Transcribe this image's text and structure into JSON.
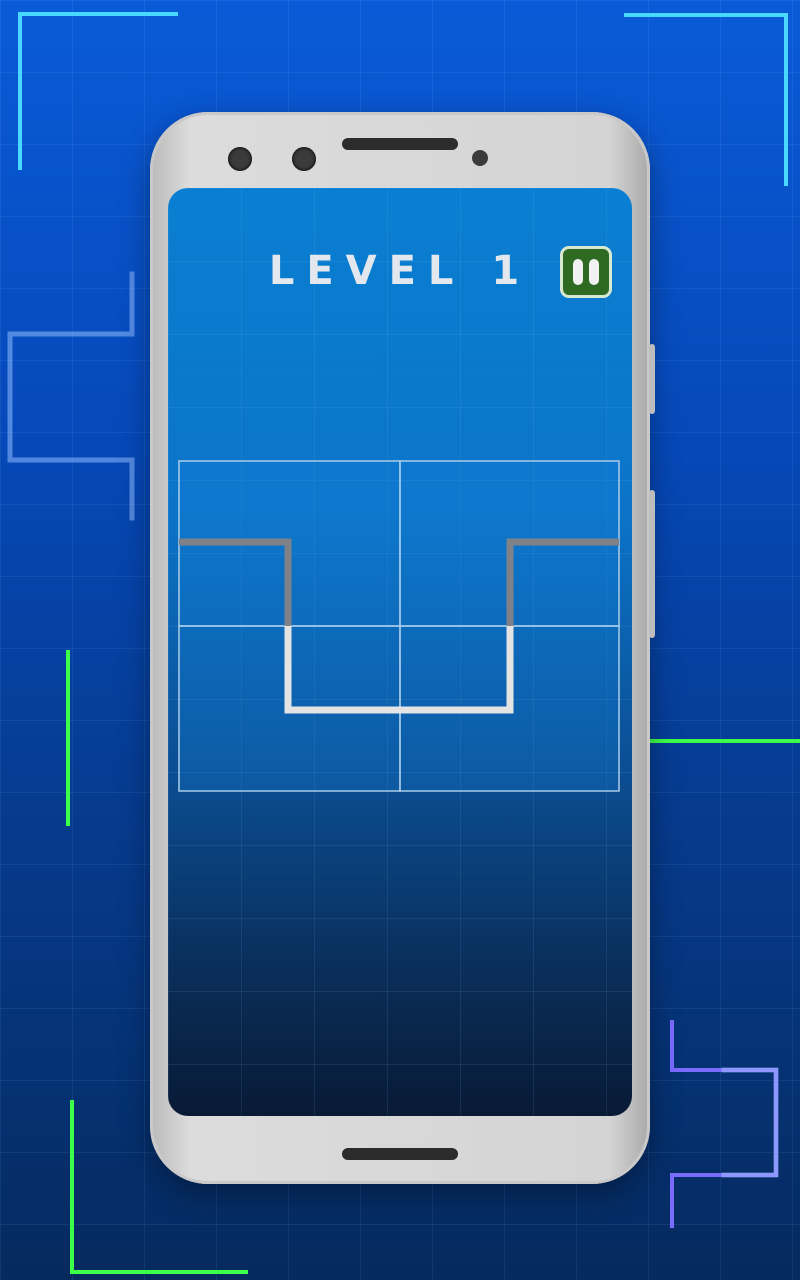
{
  "header": {
    "title": "LEVEL 1",
    "pause_icon": "pause-icon"
  },
  "board": {
    "rows": 2,
    "cols": 2,
    "tiles": [
      {
        "row": 0,
        "col": 0,
        "segments": [
          "left-to-right-then-down"
        ],
        "color": "#7e8288"
      },
      {
        "row": 0,
        "col": 1,
        "segments": [
          "left-up-then-right"
        ],
        "color": "#7e8288"
      },
      {
        "row": 1,
        "col": 0,
        "segments": [
          "top-down-then-right"
        ],
        "color": "#e4e4e4"
      },
      {
        "row": 1,
        "col": 1,
        "segments": [
          "left-then-up"
        ],
        "color": "#e4e4e4"
      }
    ]
  },
  "colors": {
    "background": "#0648b8",
    "screen": "#0b74c8",
    "pause_button": "#2f6a23",
    "tile_border": "#a9cdea",
    "inactive_path": "#7e8288",
    "active_path": "#e4e4e4",
    "deco_cyan": "#3fd4ff",
    "deco_green": "#3cff4a",
    "deco_purple": "#6a5cff"
  }
}
